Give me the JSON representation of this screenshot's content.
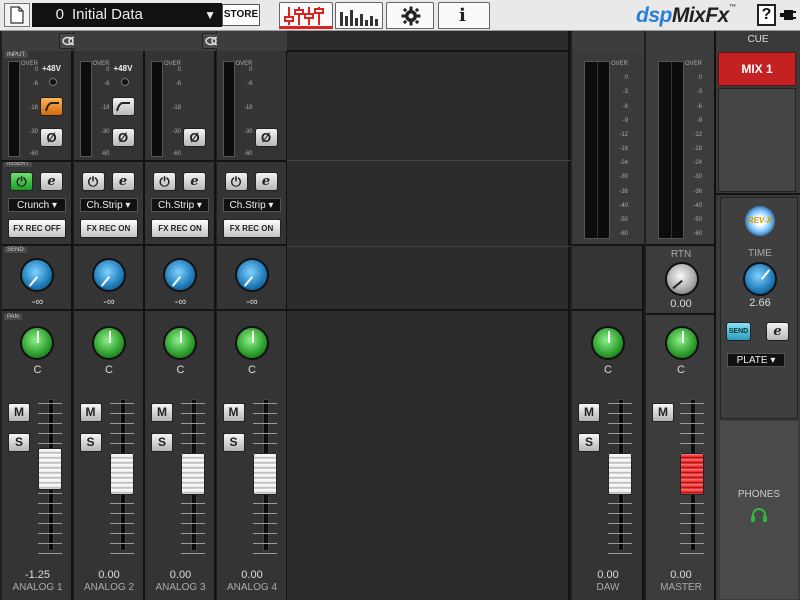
{
  "preset": {
    "number": "0",
    "name": "Initial Data",
    "store_label": "STORE"
  },
  "nav": [
    {
      "name": "mixer-tab",
      "icon": "mixer-faders-icon",
      "active": true
    },
    {
      "name": "meters-tab",
      "icon": "meter-bars-icon",
      "active": false
    },
    {
      "name": "settings-tab",
      "icon": "gear-icon",
      "active": false
    },
    {
      "name": "info-tab",
      "icon": "info-icon",
      "active": false
    }
  ],
  "brand": {
    "part1": "dsp",
    "part2": "MixFx",
    "tm": "™"
  },
  "help_label": "?",
  "sections": {
    "input": "INPUT",
    "insert": "INSERT",
    "send": "SEND",
    "pan": "PAN"
  },
  "meter_scale": [
    "OVER",
    "0",
    "-6",
    "-18",
    "-30",
    "-60"
  ],
  "daw_meter_scale": [
    "OVER",
    "0",
    "-3",
    "-6",
    "-9",
    "-12",
    "-18",
    "-24",
    "-30",
    "-36",
    "-40",
    "-50",
    "-60"
  ],
  "channels": [
    {
      "name": "ANALOG 1",
      "level": "-1.25",
      "phantom": "+48V",
      "hpf_on": true,
      "insert_on": true,
      "effect": "Crunch",
      "fxrec": "FX REC OFF",
      "send": "-∞",
      "pan": "C",
      "fader": 0.55
    },
    {
      "name": "ANALOG 2",
      "level": "0.00",
      "phantom": "+48V",
      "hpf_on": false,
      "insert_on": false,
      "effect": "Ch.Strip",
      "fxrec": "FX REC ON",
      "send": "-∞",
      "pan": "C",
      "fader": 0.5
    },
    {
      "name": "ANALOG 3",
      "level": "0.00",
      "phantom": "",
      "hpf_on": false,
      "insert_on": false,
      "effect": "Ch.Strip",
      "fxrec": "FX REC ON",
      "send": "-∞",
      "pan": "C",
      "fader": 0.5
    },
    {
      "name": "ANALOG 4",
      "level": "0.00",
      "phantom": "",
      "hpf_on": false,
      "insert_on": false,
      "effect": "Ch.Strip",
      "fxrec": "FX REC ON",
      "send": "-∞",
      "pan": "C",
      "fader": 0.5
    }
  ],
  "daw": {
    "name": "DAW",
    "level": "0.00",
    "pan": "C",
    "fader": 0.5
  },
  "master": {
    "name": "MASTER",
    "level": "0.00",
    "rtn_label": "RTN",
    "rtn_value": "0.00",
    "pan": "C",
    "fader": 0.5
  },
  "cue": {
    "header": "CUE",
    "mix_label": "MIX 1"
  },
  "reverb": {
    "logo_text": "REV-X",
    "time_label": "TIME",
    "time_value": "2.66",
    "send_label": "SEND",
    "type": "PLATE"
  },
  "phones": {
    "label": "PHONES",
    "icon": "headphones-icon"
  },
  "buttons": {
    "mute": "M",
    "solo": "S",
    "edit": "e",
    "power": "⏻",
    "phase": "Ø"
  },
  "colors": {
    "accent_red": "#d92828",
    "green": "#2fae3a",
    "orange": "#e0801e",
    "brand_blue": "#2a7fd4"
  }
}
